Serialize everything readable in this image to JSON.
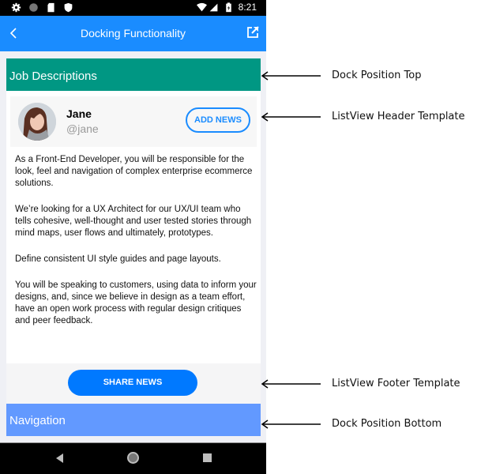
{
  "status_bar": {
    "left_icons": [
      "settings-icon",
      "circle-icon",
      "sd-card-icon",
      "shield-icon"
    ],
    "right_icons": [
      "wifi-icon",
      "signal-icon",
      "battery-icon"
    ],
    "time": "8:21"
  },
  "nav_bar": {
    "title": "Docking Functionality",
    "back_icon": "chevron-left-icon",
    "action_icon": "open-external-icon",
    "color": "#1a8cff"
  },
  "dock_top": {
    "label": "Job Descriptions",
    "color": "#009783"
  },
  "list_header": {
    "name": "Jane",
    "handle": "@jane",
    "button_label": "ADD NEWS"
  },
  "items": [
    "As a Front-End Developer, you will be responsible for the look, feel and navigation of complex enterprise ecommerce solutions.",
    "We’re looking for a UX Architect for our UX/UI team who tells cohesive, well-thought and user tested stories through mind maps, user flows and ultimately, prototypes.",
    "Define consistent UI style guides and page layouts.",
    "You will be speaking to customers, using data to inform your designs, and, since we believe in design as a team effort, have an open work process with regular design critiques and peer feedback."
  ],
  "list_footer": {
    "button_label": "SHARE NEWS"
  },
  "dock_bottom": {
    "label": "Navigation",
    "color": "#6299ff"
  },
  "annotations": [
    "Dock Position Top",
    "ListView Header Template",
    "ListView Footer Template",
    "Dock Position Bottom"
  ]
}
